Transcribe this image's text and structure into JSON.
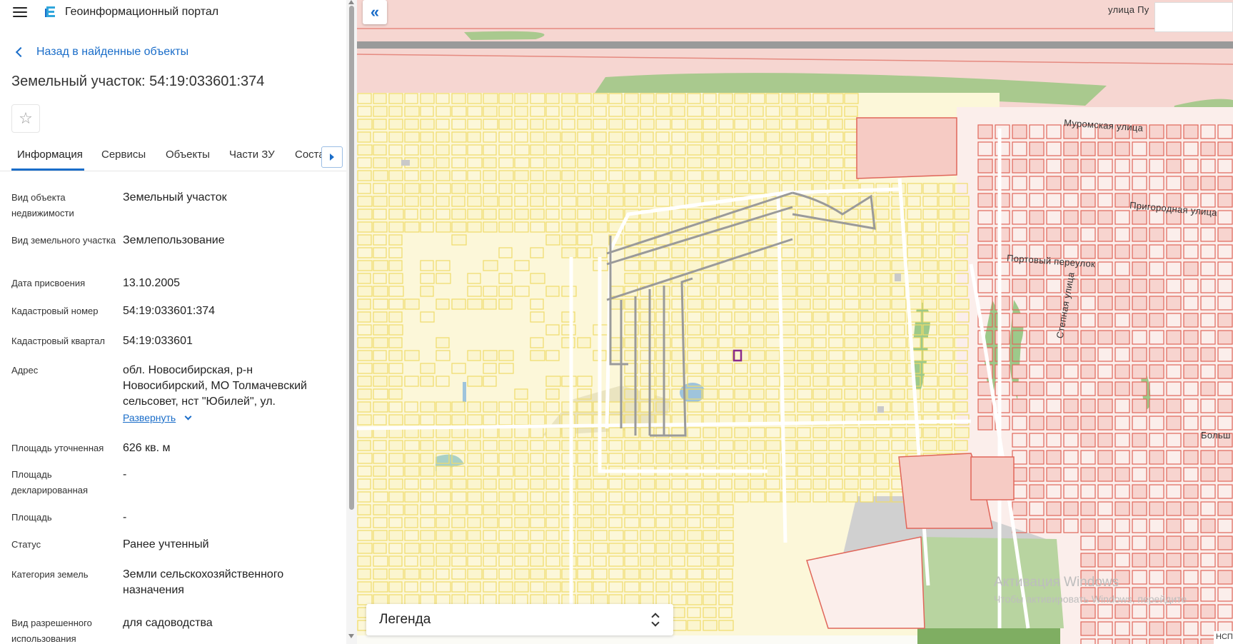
{
  "header": {
    "menu_icon": "hamburger-menu-icon",
    "logo_icon": "portal-logo-icon",
    "title": "Геоинформационный портал"
  },
  "back_link": {
    "label": "Назад в найденные объекты",
    "icon": "chevron-left-icon"
  },
  "page_title": "Земельный участок: 54:19:033601:374",
  "favorite": {
    "icon": "star-icon"
  },
  "tabs": [
    {
      "label": "Информация",
      "active": true
    },
    {
      "label": "Сервисы"
    },
    {
      "label": "Объекты"
    },
    {
      "label": "Части ЗУ"
    },
    {
      "label": "Соста"
    }
  ],
  "properties": [
    {
      "label": "Вид объекта недвижимости",
      "value": "Земельный участок"
    },
    {
      "label": "Вид земельного участка",
      "value": "Землепользование"
    },
    {
      "label": "Дата присвоения",
      "value": "13.10.2005"
    },
    {
      "label": "Кадастровый номер",
      "value": "54:19:033601:374"
    },
    {
      "label": "Кадастровый квартал",
      "value": "54:19:033601"
    },
    {
      "label": "Адрес",
      "value": "обл. Новосибирская, р-н Новосибирский, МО Толмачевский сельсовет, нст \"Юбилей\", ул.",
      "expand": "Развернуть"
    },
    {
      "label": "Площадь уточненная",
      "value": "626 кв. м"
    },
    {
      "label": "Площадь декларированная",
      "value": "-"
    },
    {
      "label": "Площадь",
      "value": "-"
    },
    {
      "label": "Статус",
      "value": "Ранее учтенный"
    },
    {
      "label": "Категория земель",
      "value": "Земли сельскохозяйственного назначения"
    },
    {
      "label": "Вид разрешенного использования",
      "value": "для садоводства"
    }
  ],
  "map": {
    "collapse_icon": "double-chevron-left-icon",
    "legend_label": "Легенда",
    "streets": {
      "muromskaya": "Муромская улица",
      "prigorodnaya": "Пригородная улица",
      "portovy": "Портовый переулок",
      "stepnaya": "Степная улица",
      "top": "улица Пу",
      "bolsh": "Больш"
    },
    "watermark_line1": "Активация Windows",
    "watermark_line2": "Чтобы активировать Windows, перейдите",
    "corner_tag": "НСП",
    "colors": {
      "parcel_yellow": "#f0dc6a",
      "parcel_yellow_fill": "#fbf5cf",
      "parcel_red": "#e0665a",
      "parcel_red_fill": "#f7d4cf",
      "green": "#a7c78a",
      "highlight": "#8a2b8a"
    }
  }
}
